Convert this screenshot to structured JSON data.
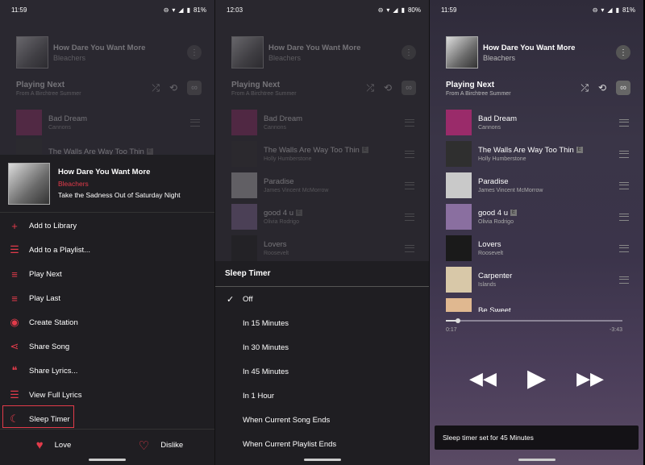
{
  "now_playing": {
    "title": "How Dare You Want More",
    "artist": "Bleachers",
    "menu_icon": "more-icon"
  },
  "playing_next": {
    "heading": "Playing Next",
    "subtitle": "From A Birchtree Summer"
  },
  "queue": [
    {
      "title": "Bad Dream",
      "artist": "Cannons",
      "explicit": false,
      "color": "#9a2b6a"
    },
    {
      "title": "The Walls Are Way Too Thin",
      "artist": "Holly Humberstone",
      "explicit": true,
      "color": "#2f2f2f"
    },
    {
      "title": "Paradise",
      "artist": "James Vincent McMorrow",
      "explicit": false,
      "color": "#c9c9c9"
    },
    {
      "title": "good 4 u",
      "artist": "Olivia Rodrigo",
      "explicit": true,
      "color": "#8a6fa0"
    },
    {
      "title": "Lovers",
      "artist": "Roosevelt",
      "explicit": false,
      "color": "#1a1a1a"
    },
    {
      "title": "Carpenter",
      "artist": "Islands",
      "explicit": false,
      "color": "#d8c8a8"
    },
    {
      "title": "Be Sweet",
      "artist": "",
      "explicit": false,
      "color": "#e0b890"
    }
  ],
  "panel1": {
    "time": "11:59",
    "battery": "81%",
    "sheet_title": "How Dare You Want More",
    "sheet_artist": "Bleachers",
    "sheet_album": "Take the Sadness Out of Saturday Night",
    "menu": [
      {
        "label": "Add to Library",
        "icon": "plus-icon",
        "glyph": "+"
      },
      {
        "label": "Add to a Playlist...",
        "icon": "playlist-add-icon",
        "glyph": "☰"
      },
      {
        "label": "Play Next",
        "icon": "play-next-icon",
        "glyph": "≡"
      },
      {
        "label": "Play Last",
        "icon": "play-last-icon",
        "glyph": "≡"
      },
      {
        "label": "Create Station",
        "icon": "station-icon",
        "glyph": "◉"
      },
      {
        "label": "Share Song",
        "icon": "share-icon",
        "glyph": "⋖"
      },
      {
        "label": "Share Lyrics...",
        "icon": "lyrics-share-icon",
        "glyph": "❝"
      },
      {
        "label": "View Full Lyrics",
        "icon": "lyrics-icon",
        "glyph": "☰"
      },
      {
        "label": "Sleep Timer",
        "icon": "moon-icon",
        "glyph": "☾"
      }
    ],
    "love_label": "Love",
    "dislike_label": "Dislike"
  },
  "panel2": {
    "time": "12:03",
    "battery": "80%",
    "sheet_title": "Sleep Timer",
    "options": [
      "Off",
      "In 15 Minutes",
      "In 30 Minutes",
      "In 45 Minutes",
      "In 1 Hour",
      "When Current Song Ends",
      "When Current Playlist Ends"
    ],
    "selected": "Off"
  },
  "panel3": {
    "time": "11:59",
    "battery": "81%",
    "elapsed": "0:17",
    "remaining": "-3:43",
    "progress": 0.07,
    "toast": "Sleep timer set for 45 Minutes"
  },
  "colors": {
    "accent": "#e23b4a"
  }
}
